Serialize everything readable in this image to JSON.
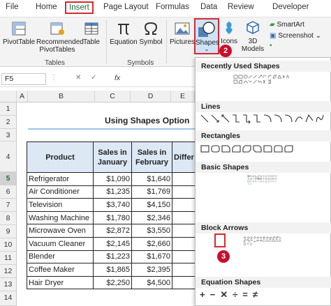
{
  "ribbon_tabs": [
    "File",
    "Home",
    "Insert",
    "Page Layout",
    "Formulas",
    "Data",
    "Review",
    "Developer"
  ],
  "steps": [
    "1",
    "2",
    "3"
  ],
  "ribbon": {
    "pivottable": "PivotTable",
    "recommended": "Recommended PivotTables",
    "table": "Table",
    "tables_group": "Tables",
    "equation": "Equation",
    "symbol": "Symbol",
    "symbols_group": "Symbols",
    "pictures": "Pictures",
    "shapes": "Shapes",
    "icons": "Icons",
    "models": "3D Models",
    "smartart": "SmartArt",
    "screenshot": "Screenshot"
  },
  "name_box": "F5",
  "fx": "fx",
  "columns": [
    "A",
    "B",
    "C",
    "D",
    "E"
  ],
  "rows": [
    "1",
    "2",
    "3",
    "4",
    "5",
    "6",
    "7",
    "8",
    "9",
    "10",
    "11",
    "12",
    "13",
    "14"
  ],
  "sheet_title": "Using Shapes Option",
  "table": {
    "headers": [
      "Product",
      "Sales in January",
      "Sales in February",
      "Differ"
    ],
    "rows": [
      [
        "Refrigerator",
        "$1,090",
        "$1,640"
      ],
      [
        "Air Conditioner",
        "$1,235",
        "$1,769"
      ],
      [
        "Television",
        "$3,740",
        "$4,150"
      ],
      [
        "Washing Machine",
        "$1,780",
        "$2,346"
      ],
      [
        "Microwave Oven",
        "$2,872",
        "$3,550"
      ],
      [
        "Vacuum Cleaner",
        "$2,145",
        "$2,660"
      ],
      [
        "Blender",
        "$1,223",
        "$1,670"
      ],
      [
        "Coffee Maker",
        "$1,865",
        "$2,395"
      ],
      [
        "Hair Dryer",
        "$2,250",
        "$4,500"
      ]
    ]
  },
  "dropdown": {
    "sections": [
      "Recently Used Shapes",
      "Lines",
      "Rectangles",
      "Basic Shapes",
      "Block Arrows",
      "Equation Shapes"
    ],
    "equation_glyphs": [
      "+",
      "−",
      "✕",
      "÷",
      "=",
      "≠"
    ]
  },
  "colors": {
    "excel_green": "#1e6b3a",
    "highlight_red": "#d8282f",
    "badge_red": "#c8102e",
    "header_fill": "#dde8f5"
  }
}
